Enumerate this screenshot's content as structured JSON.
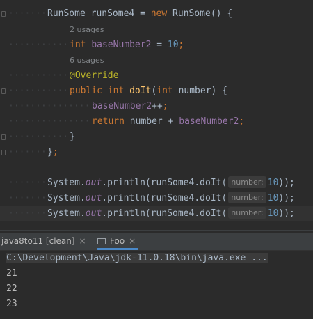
{
  "editor": {
    "line1": {
      "type": "RunSome",
      "var": "runSome4",
      "eq": " = ",
      "new": "new",
      "ctor": "RunSome",
      "rest": "() {"
    },
    "hint_usages_a": "2 usages",
    "line2": {
      "kw": "int",
      "field": "baseNumber2",
      "eq": " = ",
      "num": "10",
      "semi": ";"
    },
    "hint_usages_b": "6 usages",
    "annotation": "@Override",
    "line4": {
      "kw1": "public",
      "kw2": "int",
      "method": "doIt",
      "open": "(",
      "kw3": "int",
      "param": "number",
      "close": ") {"
    },
    "line5": {
      "field": "baseNumber2",
      "op": "++",
      "semi": ";"
    },
    "line6": {
      "kw": "return",
      "a": "number",
      "op": " + ",
      "field": "baseNumber2",
      "semi": ";"
    },
    "line7": "}",
    "line8": {
      "brace": "}",
      "semi": ";"
    },
    "println_lines": [
      {
        "cls": "System.",
        "out": "out",
        "call": ".println(runSome4.doIt(",
        "hint": "number:",
        "num": "10",
        "end": "));"
      },
      {
        "cls": "System.",
        "out": "out",
        "call": ".println(runSome4.doIt(",
        "hint": "number:",
        "num": "10",
        "end": "));"
      },
      {
        "cls": "System.",
        "out": "out",
        "call": ".println(runSome4.doIt(",
        "hint": "number:",
        "num": "10",
        "end": "));"
      }
    ]
  },
  "tabs": [
    {
      "label": "java8to11 [clean]",
      "close": "×"
    },
    {
      "label": "Foo",
      "close": "×"
    }
  ],
  "console": {
    "command": "C:\\Development\\Java\\jdk-11.0.18\\bin\\java.exe ...",
    "output": [
      "21",
      "22",
      "23"
    ]
  }
}
